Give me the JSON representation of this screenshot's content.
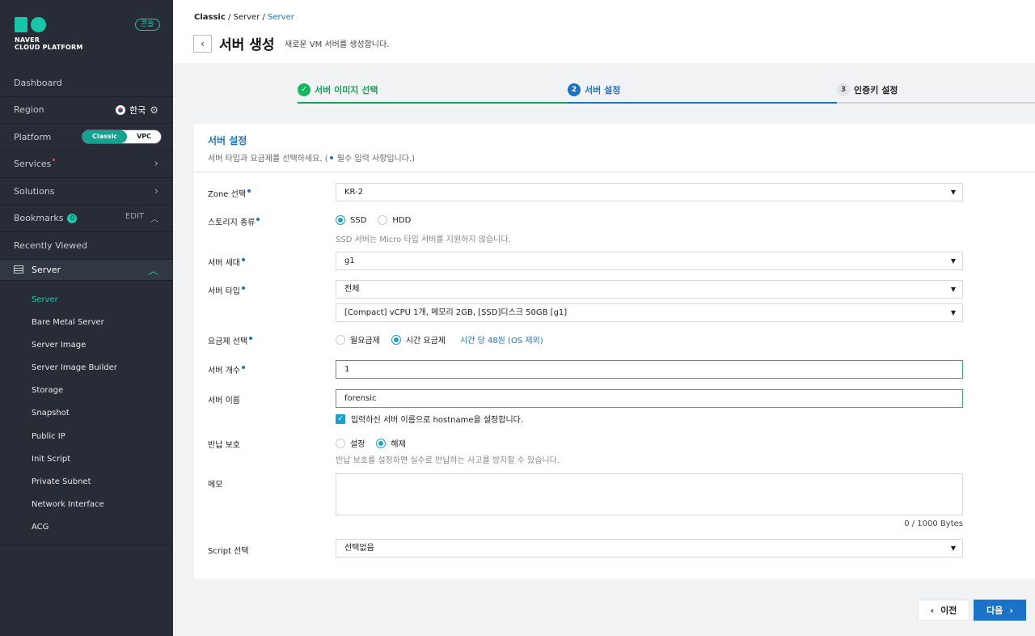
{
  "brand": {
    "line1": "NAVER",
    "line2": "CLOUD PLATFORM",
    "console_badge": "콘솔",
    "accent": "#19c6a8"
  },
  "sidebar": {
    "dashboard": "Dashboard",
    "region_label": "Region",
    "region_value": "한국",
    "platform_label": "Platform",
    "platform_options": [
      "Classic",
      "VPC"
    ],
    "platform_selected": "Classic",
    "services": "Services",
    "solutions": "Solutions",
    "bookmarks": "Bookmarks",
    "bookmarks_count": "0",
    "bookmarks_edit": "EDIT",
    "recently_viewed": "Recently Viewed",
    "server_group": "Server",
    "server_items": [
      "Server",
      "Bare Metal Server",
      "Server Image",
      "Server Image Builder",
      "Storage",
      "Snapshot",
      "Public IP",
      "Init Script",
      "Private Subnet",
      "Network Interface",
      "ACG"
    ],
    "active_item": "Server"
  },
  "header": {
    "breadcrumb": [
      "Classic",
      "Server",
      "Server"
    ],
    "title": "서버 생성",
    "subtitle": "새로운 VM 서버를 생성합니다."
  },
  "steps": [
    {
      "num": "✓",
      "label": "서버 이미지 선택",
      "state": "done"
    },
    {
      "num": "2",
      "label": "서버 설정",
      "state": "current"
    },
    {
      "num": "3",
      "label": "인증키 설정",
      "state": "todo"
    }
  ],
  "form": {
    "title": "서버 설정",
    "desc_prefix": "서버 타입과 요금제를 선택하세요. (",
    "desc_suffix": " 필수 입력 사항입니다.)",
    "zone": {
      "label": "Zone 선택",
      "value": "KR-2"
    },
    "storage": {
      "label": "스토리지 종류",
      "options": [
        "SSD",
        "HDD"
      ],
      "selected": "SSD",
      "hint": "SSD 서버는 Micro 타입 서버를 지원하지 않습니다."
    },
    "generation": {
      "label": "서버 세대",
      "value": "g1"
    },
    "server_type": {
      "label": "서버 타입",
      "value": "전체",
      "spec": "[Compact] vCPU 1개, 메모리 2GB, [SSD]디스크 50GB [g1]"
    },
    "pricing": {
      "label": "요금제 선택",
      "options": [
        "월요금제",
        "시간 요금제"
      ],
      "selected": "시간 요금제",
      "price": "시간 당 48원 (OS 제외)"
    },
    "count": {
      "label": "서버 개수",
      "value": "1"
    },
    "name": {
      "label": "서버 이름",
      "value": "forensic",
      "checkbox": "입력하신 서버 이름으로 hostname을 설정합니다."
    },
    "return_protect": {
      "label": "반납 보호",
      "options": [
        "설정",
        "해제"
      ],
      "selected": "해제",
      "hint": "반납 보호를 설정하면 실수로 반납하는 사고를 방지할 수 있습니다."
    },
    "memo": {
      "label": "메모",
      "value": "",
      "bytes": "0 / 1000 Bytes"
    },
    "script": {
      "label": "Script 선택",
      "value": "선택없음"
    }
  },
  "buttons": {
    "prev": "이전",
    "next": "다음"
  }
}
